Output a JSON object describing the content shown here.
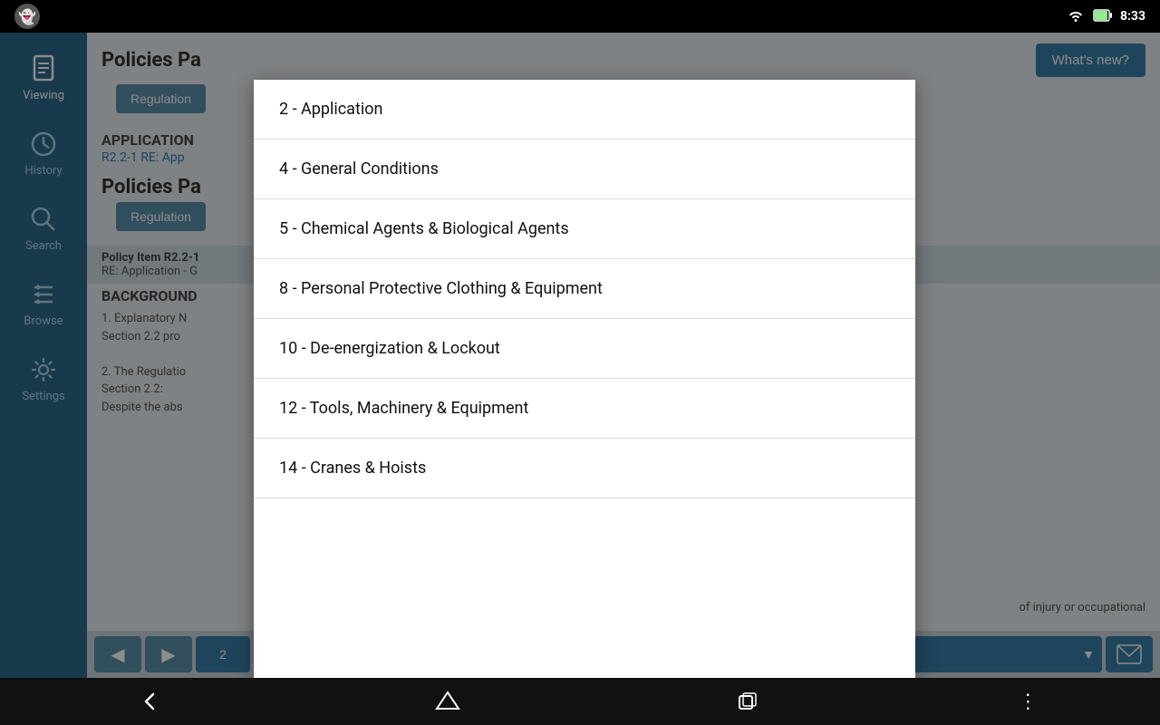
{
  "statusBar": {
    "time": "8:33",
    "ghostIcon": "👻"
  },
  "sidebar": {
    "items": [
      {
        "id": "viewing",
        "label": "Viewing",
        "icon": "document",
        "active": true
      },
      {
        "id": "history",
        "label": "History",
        "icon": "clock",
        "active": false
      },
      {
        "id": "search",
        "label": "Search",
        "icon": "search",
        "active": false
      },
      {
        "id": "browse",
        "label": "Browse",
        "icon": "list",
        "active": false
      },
      {
        "id": "settings",
        "label": "Settings",
        "icon": "wrench",
        "active": false
      }
    ]
  },
  "header": {
    "title": "Policies Pa",
    "whatsNewLabel": "What's new?"
  },
  "content": {
    "sections": [
      {
        "tag": "APPLICATION",
        "refText": "R2.2-1 RE: App",
        "regulationLabel": "Regulation"
      },
      {
        "tag": "Policies Pa",
        "regulationLabel": "Regulation"
      }
    ],
    "policyItem": {
      "label": "Policy Item R2.2-1",
      "desc": "RE: Application - G"
    },
    "background": {
      "title": "BACKGROUND",
      "lines": [
        "1. Explanatory N",
        "Section 2.2 pro",
        "2. The Regulatio",
        "Section 2.2:",
        "Despite the abs"
      ]
    },
    "bottomRight": "of injury or occupational"
  },
  "bottomNav": {
    "backLabel": "◀",
    "forwardLabel": "▶",
    "pageValue": "2",
    "dropdownArrow": "▼"
  },
  "dropdownModal": {
    "items": [
      {
        "id": "item-2",
        "label": "2 - Application"
      },
      {
        "id": "item-4",
        "label": "4 - General Conditions"
      },
      {
        "id": "item-5",
        "label": "5 - Chemical Agents & Biological Agents"
      },
      {
        "id": "item-8",
        "label": "8 - Personal Protective Clothing & Equipment"
      },
      {
        "id": "item-10",
        "label": "10 - De-energization & Lockout"
      },
      {
        "id": "item-12",
        "label": "12 - Tools, Machinery & Equipment"
      },
      {
        "id": "item-14",
        "label": "14 - Cranes & Hoists"
      }
    ]
  },
  "androidNav": {
    "backSymbol": "←",
    "homeSymbol": "⬡",
    "recentSymbol": "▭",
    "moreSymbol": "⋮"
  }
}
